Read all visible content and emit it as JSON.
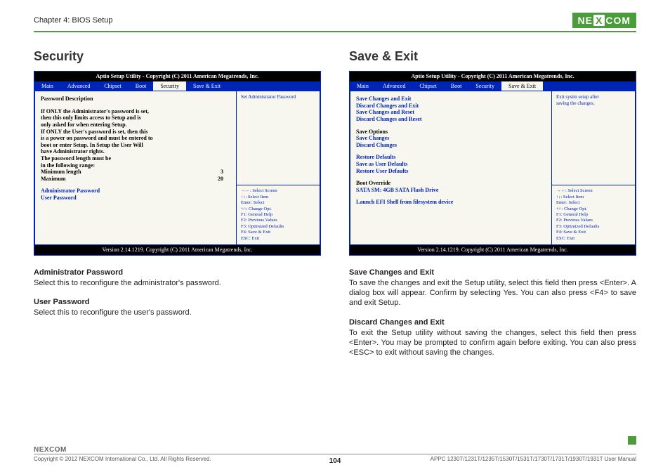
{
  "header": {
    "chapter": "Chapter 4: BIOS Setup",
    "brand_pre": "NE",
    "brand_x": "X",
    "brand_post": "COM"
  },
  "left": {
    "title": "Security",
    "bios_header": "Aptio Setup Utility - Copyright (C) 2011 American Megatrends, Inc.",
    "tabs": [
      "Main",
      "Advanced",
      "Chipset",
      "Boot",
      "Security",
      "Save & Exit"
    ],
    "active_tab_index": 4,
    "body": {
      "lead": "Password Description",
      "para": [
        "If ONLY the Administrator's password is set,",
        "then this only limits access to Setup and is",
        "only asked for when entering Setup.",
        "If ONLY the User's password is set, then this",
        "is a power on password and must be entered to",
        "boot or enter Setup. In Setup the User Will",
        "have Administrator rights.",
        "The password length must be",
        "in the following range:"
      ],
      "min_label": "Minimum length",
      "min_val": "3",
      "max_label": "Maximum",
      "max_val": "20",
      "items": [
        "Administrator Password",
        "User Password"
      ]
    },
    "right_top": "Set Administrator Password",
    "right_bot": [
      "→←: Select Screen",
      "↑↓: Select Item",
      "Enter: Select",
      "+/-: Change Opt.",
      "F1: General Help",
      "F2: Previous Values",
      "F3: Optimized Defaults",
      "F4: Save & Exit",
      "ESC: Exit"
    ],
    "version": "Version 2.14.1219. Copyright (C) 2011 American Megatrends, Inc.",
    "sections": {
      "admin_t": "Administrator Password",
      "admin_b": "Select this to reconfigure the administrator's password.",
      "user_t": "User Password",
      "user_b": "Select this to reconfigure the user's password."
    }
  },
  "right": {
    "title": "Save & Exit",
    "bios_header": "Aptio Setup Utility - Copyright (C) 2011 American Megatrends, Inc.",
    "tabs": [
      "Main",
      "Advanced",
      "Chipset",
      "Boot",
      "Security",
      "Save & Exit"
    ],
    "active_tab_index": 5,
    "body": {
      "group1": [
        "Save Changes and Exit",
        "Discard Changes and Exit",
        "Save Changes and Reset",
        "Discard Changes and Reset"
      ],
      "group2_label": "Save Options",
      "group2": [
        "Save Changes",
        "Discard Changes"
      ],
      "group3": [
        "Restore Defaults",
        "Save as User Defaults",
        "Restore User Defaults"
      ],
      "group4_label": "Boot Override",
      "group4": [
        "SATA SM: 4GB SATA Flash Drive"
      ],
      "group5": [
        "Launch EFI Shell from filesystem device"
      ]
    },
    "right_top": [
      "Exit systm setup after",
      "saving the changes."
    ],
    "right_bot": [
      "→←: Select Screen",
      "↑↓: Select Item",
      "Enter: Select",
      "+/-: Change Opt.",
      "F1: General Help",
      "F2: Previous Values",
      "F3: Optimized Defaults",
      "F4: Save & Exit",
      "ESC: Exit"
    ],
    "version": "Version 2.14.1219. Copyright (C) 2011 American Megatrends, Inc.",
    "sections": {
      "save_t": "Save Changes and Exit",
      "save_b": "To save the changes and exit the Setup utility, select this field then press <Enter>. A dialog box will appear. Confirm by selecting Yes. You can also press <F4> to save and exit Setup.",
      "disc_t": "Discard Changes and Exit",
      "disc_b": "To exit the Setup utility without saving the changes, select this field then press <Enter>. You may be prompted to confirm again before exiting. You can also press <ESC> to exit without saving the changes."
    }
  },
  "footer": {
    "logo": "NEXCOM",
    "copyright": "Copyright © 2012 NEXCOM International Co., Ltd. All Rights Reserved.",
    "page": "104",
    "product": "APPC 1230T/1231T/1235T/1530T/1531T/1730T/1731T/1930T/1931T User Manual"
  }
}
